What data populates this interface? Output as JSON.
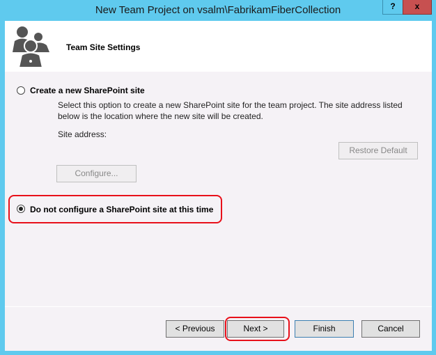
{
  "window": {
    "title": "New Team Project on vsalm\\FabrikamFiberCollection",
    "help_label": "?",
    "close_label": "x"
  },
  "header": {
    "title": "Team Site Settings",
    "icon": "team-people-icon"
  },
  "options": {
    "create": {
      "label": "Create a new SharePoint site",
      "selected": false,
      "description": "Select this option to create a new SharePoint site for the team project. The site address listed below is the location where the new site will be created.",
      "site_address_label": "Site address:",
      "restore_default_label": "Restore Default",
      "configure_label": "Configure..."
    },
    "none": {
      "label": "Do not configure a SharePoint site at this time",
      "selected": true
    }
  },
  "footer": {
    "previous_label": "< Previous",
    "next_label": "Next >",
    "finish_label": "Finish",
    "cancel_label": "Cancel"
  },
  "colors": {
    "frame": "#5fcaee",
    "highlight": "#e8101a",
    "close": "#c75050"
  }
}
